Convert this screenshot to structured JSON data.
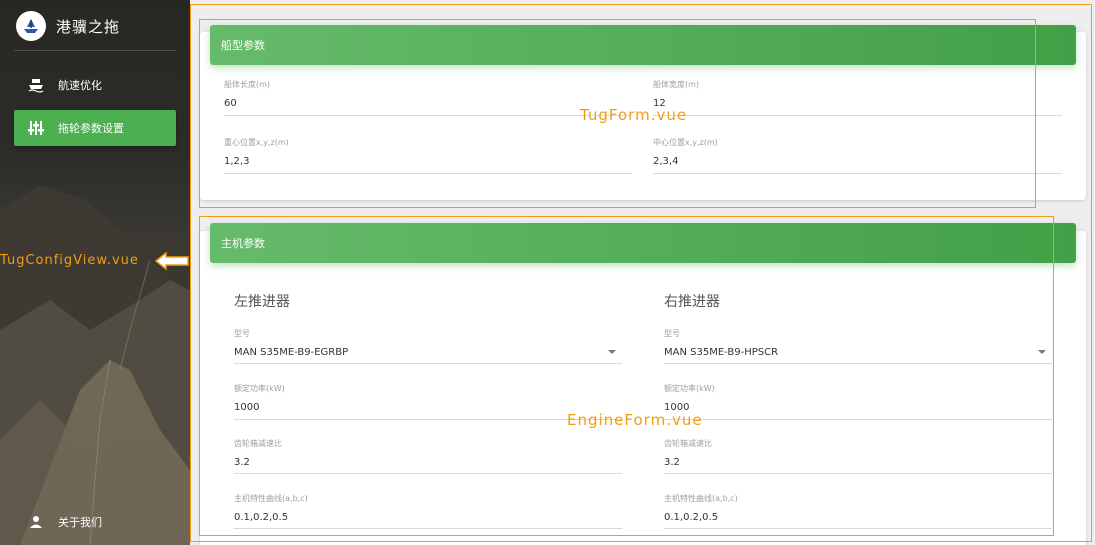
{
  "app": {
    "title": "港骥之拖"
  },
  "sidebar": {
    "items": [
      {
        "label": "航速优化",
        "icon": "ship-icon",
        "active": false
      },
      {
        "label": "拖轮参数设置",
        "icon": "sliders-icon",
        "active": true
      }
    ],
    "footer": {
      "label": "关于我们",
      "icon": "person-icon"
    }
  },
  "hull_card": {
    "title": "船型参数",
    "fields": [
      {
        "label": "船体长度(m)",
        "value": "60"
      },
      {
        "label": "船体宽度(m)",
        "value": "12"
      },
      {
        "label": "重心位置x,y,z(m)",
        "value": "1,2,3"
      },
      {
        "label": "中心位置x,y,z(m)",
        "value": "2,3,4"
      }
    ]
  },
  "engine_card": {
    "title": "主机参数",
    "left": {
      "heading": "左推进器",
      "model_label": "型号",
      "model_value": "MAN S35ME-B9-EGRBP",
      "power_label": "额定功率(kW)",
      "power_value": "1000",
      "gear_label": "齿轮箱减速比",
      "gear_value": "3.2",
      "curve_label": "主机特性曲线(a,b,c)",
      "curve_value": "0.1,0.2,0.5"
    },
    "right": {
      "heading": "右推进器",
      "model_label": "型号",
      "model_value": "MAN S35ME-B9-HPSCR",
      "power_label": "额定功率(kW)",
      "power_value": "1000",
      "gear_label": "齿轮箱减速比",
      "gear_value": "3.2",
      "curve_label": "主机特性曲线(a,b,c)",
      "curve_value": "0.1,0.2,0.5"
    }
  },
  "annotations": {
    "tug_form": "TugForm.vue",
    "engine_form": "EngineForm.vue",
    "config_view": "TugConfigView.vue"
  },
  "colors": {
    "accent": "#4caf50",
    "annotation": "#f39c12"
  }
}
